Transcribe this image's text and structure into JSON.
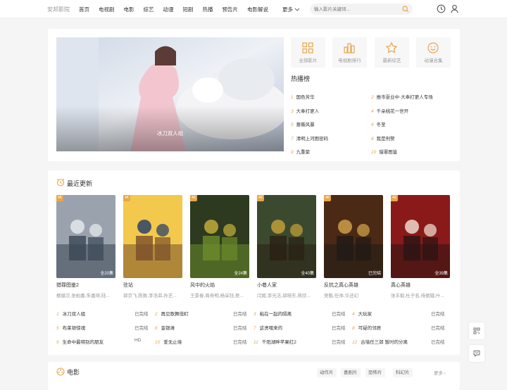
{
  "header": {
    "logo": "安邦影院",
    "nav": [
      "首页",
      "电视剧",
      "电影",
      "综艺",
      "动漫",
      "短剧",
      "热播",
      "预告片",
      "电影解说"
    ],
    "more": "更多",
    "search_placeholder": "输入影片关键词...",
    "icons": [
      "search-icon",
      "history-icon",
      "user-icon"
    ]
  },
  "banner": {
    "caption": "冰刀双人组"
  },
  "quick": [
    {
      "label": "全部影片",
      "icon": "grid-icon"
    },
    {
      "label": "电视剧排行",
      "icon": "bar-chart-icon"
    },
    {
      "label": "最新综艺",
      "icon": "star-icon"
    },
    {
      "label": "动漫合集",
      "icon": "smile-icon"
    }
  ],
  "hot": {
    "title": "热播榜",
    "items": [
      {
        "n": "1",
        "t": "国色芳华"
      },
      {
        "n": "2",
        "t": "推市耍业中·大奉打更人专场"
      },
      {
        "n": "3",
        "t": "大奉打更人"
      },
      {
        "n": "4",
        "t": "千朵桃花一世开"
      },
      {
        "n": "5",
        "t": "蔷薇风暴"
      },
      {
        "n": "6",
        "t": "冬至"
      },
      {
        "n": "7",
        "t": "清明上河图密码"
      },
      {
        "n": "8",
        "t": "我是刑警"
      },
      {
        "n": "9",
        "t": "九重紫"
      },
      {
        "n": "10",
        "t": "猎罪图鉴"
      }
    ]
  },
  "recent": {
    "title": "最近更新",
    "posters": [
      {
        "badge": "4K",
        "ep": "全20集",
        "title": "猎罪图鉴2",
        "cast": "檀健次,张柏嘉,朱嘉琦,陆..."
      },
      {
        "badge": "4K",
        "ep": "",
        "title": "驻站",
        "cast": "郭京飞,陈数,李浩菲,孙艺..."
      },
      {
        "badge": "4K",
        "ep": "全24集",
        "title": "风中的火焰",
        "cast": "王景春,周奇明,杨采钰,吴..."
      },
      {
        "badge": "4K",
        "ep": "全40集",
        "title": "小巷人家",
        "cast": "闫妮,李光洁,郭晓东,蒋欣..."
      },
      {
        "badge": "4K",
        "ep": "已完结",
        "title": "反抗之真心英雄",
        "cast": "吴魁,任帅,许还幻"
      },
      {
        "badge": "4K",
        "ep": "全39集",
        "title": "真心英雄",
        "cast": "张丰毅,杜子名,侍丽娥,叶..."
      }
    ],
    "list": [
      {
        "n": "1",
        "t": "冰刀双人组",
        "s": "已完结"
      },
      {
        "n": "2",
        "t": "再见歌舞伎町",
        "s": "已完结"
      },
      {
        "n": "3",
        "t": "粘在一起的隔离",
        "s": "已完结"
      },
      {
        "n": "4",
        "t": "大玩家",
        "s": "已完结"
      },
      {
        "n": "5",
        "t": "布莱顿惊魂",
        "s": "已完结"
      },
      {
        "n": "6",
        "t": "金银滩",
        "s": "已完结"
      },
      {
        "n": "7",
        "t": "这贤嘿来的",
        "s": "已完结"
      },
      {
        "n": "8",
        "t": "可疑的邻居",
        "s": "已完结"
      },
      {
        "n": "9",
        "t": "生命中最特别的朋友",
        "s": "HD"
      },
      {
        "n": "10",
        "t": "爱无止境",
        "s": "已完结"
      },
      {
        "n": "11",
        "t": "千阳湖畔芊果红2",
        "s": "已完结"
      },
      {
        "n": "12",
        "t": "古墙任三郎 暂时的分离",
        "s": "已完结"
      }
    ]
  },
  "movies": {
    "title": "电影",
    "tags": [
      "动作片",
      "喜剧片",
      "恐怖片",
      "科幻片"
    ],
    "more": "更多"
  },
  "accent": "#e8a64c"
}
